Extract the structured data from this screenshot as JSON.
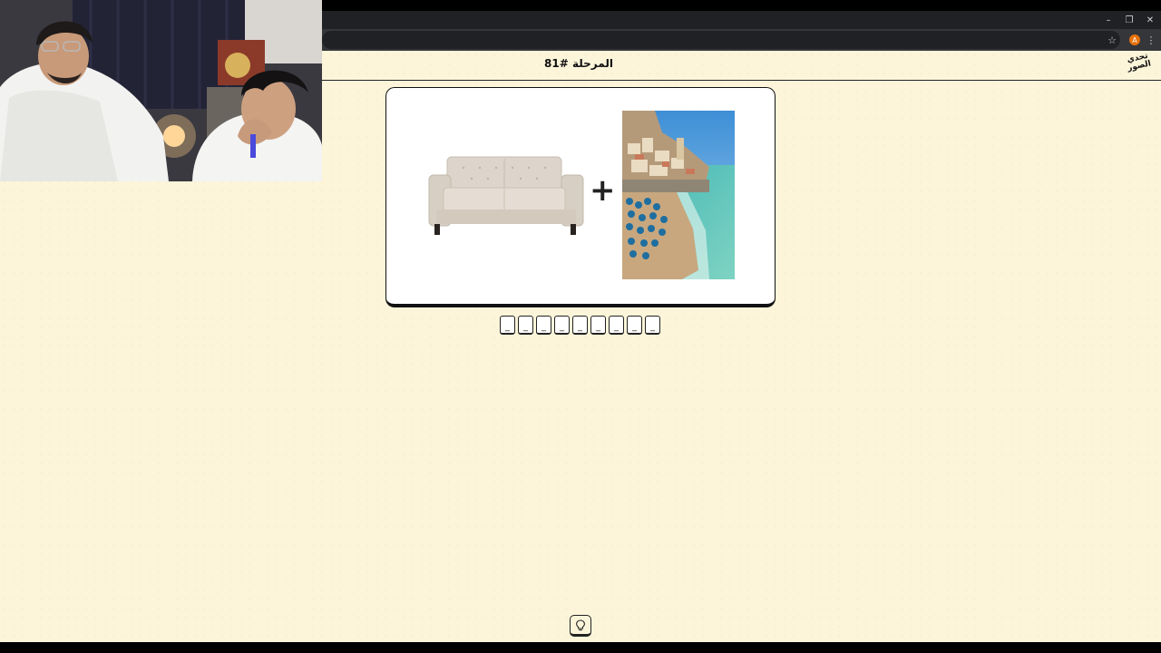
{
  "browser": {
    "window_controls": {
      "minimize": "–",
      "restore": "❐",
      "close": "✕"
    },
    "toolbar_icons": {
      "bookmark": "☆",
      "profile_initial": "A",
      "menu": "⋮"
    }
  },
  "game": {
    "stage_title": "المرحلة #81",
    "logo_text": "تحدي الصور",
    "images": [
      "sofa-image",
      "amalfi-coast-image"
    ],
    "operator": "+",
    "answer_slots": [
      "_",
      "_",
      "_",
      "_",
      "_",
      "_",
      "_",
      "_",
      "_"
    ],
    "hint_icon": "lightbulb-icon"
  },
  "webcam": {
    "content": "streamer-webcam-overlay"
  },
  "colors": {
    "page_bg": "#fdf5da",
    "card_bg": "#ffffff",
    "border": "#111111",
    "chrome_dark": "#202124"
  }
}
